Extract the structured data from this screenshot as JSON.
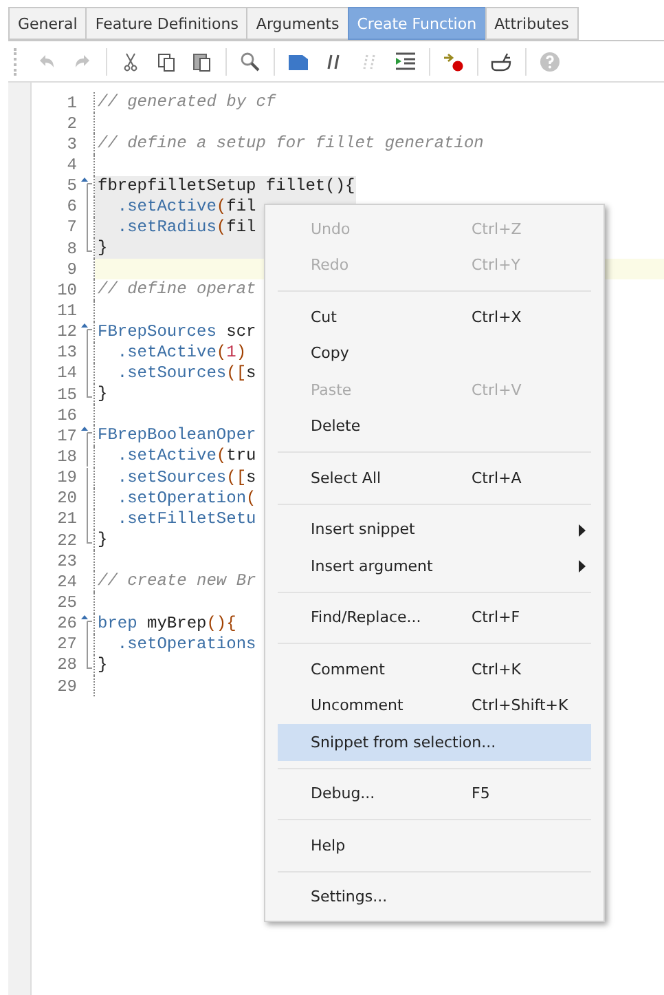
{
  "tabs": [
    {
      "label": "General",
      "selected": false
    },
    {
      "label": "Feature Definitions",
      "selected": false
    },
    {
      "label": "Arguments",
      "selected": false
    },
    {
      "label": "Create Function",
      "selected": true
    },
    {
      "label": "Attributes",
      "selected": false
    }
  ],
  "toolbar": [
    {
      "kind": "undo",
      "disabled": true
    },
    {
      "kind": "redo",
      "disabled": true
    },
    {
      "kind": "sep"
    },
    {
      "kind": "cut",
      "disabled": false
    },
    {
      "kind": "copy",
      "disabled": false
    },
    {
      "kind": "paste",
      "disabled": false
    },
    {
      "kind": "sep"
    },
    {
      "kind": "search",
      "disabled": false
    },
    {
      "kind": "sep"
    },
    {
      "kind": "block",
      "disabled": false
    },
    {
      "kind": "comment",
      "disabled": false
    },
    {
      "kind": "uncomment",
      "disabled": true
    },
    {
      "kind": "indent",
      "disabled": false
    },
    {
      "kind": "sep"
    },
    {
      "kind": "breakpoint",
      "disabled": false
    },
    {
      "kind": "sep"
    },
    {
      "kind": "tool",
      "disabled": false
    },
    {
      "kind": "sep"
    },
    {
      "kind": "help",
      "disabled": true
    }
  ],
  "editor": {
    "lines": [
      {
        "number": "1",
        "kind": "plain",
        "selected": false,
        "current": false,
        "segments": [
          {
            "kind": "comment",
            "text": "// generated by cf"
          }
        ]
      },
      {
        "number": "2",
        "kind": "plain",
        "selected": false,
        "current": false
      },
      {
        "number": "3",
        "kind": "plain",
        "selected": false,
        "current": false,
        "segments": [
          {
            "kind": "comment",
            "text": "// define a setup for fillet generation"
          }
        ]
      },
      {
        "number": "4",
        "kind": "plain",
        "selected": false,
        "current": false
      },
      {
        "number": "5",
        "kind": "start",
        "selected": true,
        "current": false,
        "segments": [
          {
            "kind": "plain",
            "text": "fbrepfilletSetup fillet(){"
          }
        ]
      },
      {
        "number": "6",
        "kind": "body",
        "selected": true,
        "current": false,
        "segments": [
          {
            "kind": "method",
            "text": "  .setActive"
          },
          {
            "kind": "paren",
            "text": "("
          },
          {
            "kind": "plain",
            "text": "fil"
          }
        ]
      },
      {
        "number": "7",
        "kind": "body",
        "selected": true,
        "current": false,
        "segments": [
          {
            "kind": "method",
            "text": "  .setRadius"
          },
          {
            "kind": "paren",
            "text": "("
          },
          {
            "kind": "plain",
            "text": "fil"
          }
        ]
      },
      {
        "number": "8",
        "kind": "end",
        "selected": true,
        "current": false,
        "segments": [
          {
            "kind": "plain",
            "text": "}"
          }
        ]
      },
      {
        "number": "9",
        "kind": "plain",
        "selected": false,
        "current": true
      },
      {
        "number": "10",
        "kind": "plain",
        "selected": false,
        "current": false,
        "segments": [
          {
            "kind": "comment",
            "text": "// define operat"
          }
        ]
      },
      {
        "number": "11",
        "kind": "plain",
        "selected": false,
        "current": false
      },
      {
        "number": "12",
        "kind": "start",
        "selected": false,
        "current": false,
        "segments": [
          {
            "kind": "type",
            "text": "FBrepSources"
          },
          {
            "kind": "plain",
            "text": " scr"
          }
        ]
      },
      {
        "number": "13",
        "kind": "body",
        "selected": false,
        "current": false,
        "segments": [
          {
            "kind": "method",
            "text": "  .setActive"
          },
          {
            "kind": "paren",
            "text": "("
          },
          {
            "kind": "number",
            "text": "1"
          },
          {
            "kind": "paren",
            "text": ")"
          }
        ]
      },
      {
        "number": "14",
        "kind": "body",
        "selected": false,
        "current": false,
        "segments": [
          {
            "kind": "method",
            "text": "  .setSources"
          },
          {
            "kind": "paren",
            "text": "(["
          },
          {
            "kind": "plain",
            "text": "s"
          }
        ]
      },
      {
        "number": "15",
        "kind": "end",
        "selected": false,
        "current": false,
        "segments": [
          {
            "kind": "plain",
            "text": "}"
          }
        ]
      },
      {
        "number": "16",
        "kind": "plain",
        "selected": false,
        "current": false
      },
      {
        "number": "17",
        "kind": "start",
        "selected": false,
        "current": false,
        "segments": [
          {
            "kind": "type",
            "text": "FBrepBooleanOper"
          }
        ]
      },
      {
        "number": "18",
        "kind": "body",
        "selected": false,
        "current": false,
        "segments": [
          {
            "kind": "method",
            "text": "  .setActive"
          },
          {
            "kind": "paren",
            "text": "("
          },
          {
            "kind": "plain",
            "text": "tru"
          }
        ]
      },
      {
        "number": "19",
        "kind": "body",
        "selected": false,
        "current": false,
        "segments": [
          {
            "kind": "method",
            "text": "  .setSources"
          },
          {
            "kind": "paren",
            "text": "(["
          },
          {
            "kind": "plain",
            "text": "s"
          }
        ]
      },
      {
        "number": "20",
        "kind": "body",
        "selected": false,
        "current": false,
        "segments": [
          {
            "kind": "method",
            "text": "  .setOperation"
          },
          {
            "kind": "paren",
            "text": "("
          }
        ]
      },
      {
        "number": "21",
        "kind": "body",
        "selected": false,
        "current": false,
        "segments": [
          {
            "kind": "method",
            "text": "  .setFilletSetu"
          }
        ]
      },
      {
        "number": "22",
        "kind": "end",
        "selected": false,
        "current": false,
        "segments": [
          {
            "kind": "plain",
            "text": "}"
          }
        ]
      },
      {
        "number": "23",
        "kind": "plain",
        "selected": false,
        "current": false
      },
      {
        "number": "24",
        "kind": "plain",
        "selected": false,
        "current": false,
        "segments": [
          {
            "kind": "comment",
            "text": "// create new Br"
          }
        ]
      },
      {
        "number": "25",
        "kind": "plain",
        "selected": false,
        "current": false
      },
      {
        "number": "26",
        "kind": "start",
        "selected": false,
        "current": false,
        "segments": [
          {
            "kind": "type",
            "text": "brep"
          },
          {
            "kind": "plain",
            "text": " myBrep"
          },
          {
            "kind": "paren",
            "text": "(){"
          }
        ]
      },
      {
        "number": "27",
        "kind": "body",
        "selected": false,
        "current": false,
        "segments": [
          {
            "kind": "method",
            "text": "  .setOperations"
          }
        ]
      },
      {
        "number": "28",
        "kind": "end",
        "selected": false,
        "current": false,
        "segments": [
          {
            "kind": "plain",
            "text": "}"
          }
        ]
      },
      {
        "number": "29",
        "kind": "plain",
        "selected": false,
        "current": false
      }
    ]
  },
  "context_menu": {
    "items": [
      {
        "kind": "item",
        "label": "Undo",
        "shortcut": "Ctrl+Z",
        "disabled": true,
        "selected": false,
        "submenu": false
      },
      {
        "kind": "item",
        "label": "Redo",
        "shortcut": "Ctrl+Y",
        "disabled": true,
        "selected": false,
        "submenu": false
      },
      {
        "kind": "separator"
      },
      {
        "kind": "item",
        "label": "Cut",
        "shortcut": "Ctrl+X",
        "disabled": false,
        "selected": false,
        "submenu": false
      },
      {
        "kind": "item",
        "label": "Copy",
        "disabled": false,
        "selected": false,
        "submenu": false
      },
      {
        "kind": "item",
        "label": "Paste",
        "shortcut": "Ctrl+V",
        "disabled": true,
        "selected": false,
        "submenu": false
      },
      {
        "kind": "item",
        "label": "Delete",
        "disabled": false,
        "selected": false,
        "submenu": false
      },
      {
        "kind": "separator"
      },
      {
        "kind": "item",
        "label": "Select All",
        "shortcut": "Ctrl+A",
        "disabled": false,
        "selected": false,
        "submenu": false
      },
      {
        "kind": "separator"
      },
      {
        "kind": "item",
        "label": "Insert snippet",
        "disabled": false,
        "selected": false,
        "submenu": true
      },
      {
        "kind": "item",
        "label": "Insert argument",
        "disabled": false,
        "selected": false,
        "submenu": true
      },
      {
        "kind": "separator"
      },
      {
        "kind": "item",
        "label": "Find/Replace...",
        "shortcut": "Ctrl+F",
        "disabled": false,
        "selected": false,
        "submenu": false
      },
      {
        "kind": "separator"
      },
      {
        "kind": "item",
        "label": "Comment",
        "shortcut": "Ctrl+K",
        "disabled": false,
        "selected": false,
        "submenu": false
      },
      {
        "kind": "item",
        "label": "Uncomment",
        "shortcut": "Ctrl+Shift+K",
        "disabled": false,
        "selected": false,
        "submenu": false
      },
      {
        "kind": "item",
        "label": "Snippet from selection...",
        "disabled": false,
        "selected": true,
        "submenu": false
      },
      {
        "kind": "separator"
      },
      {
        "kind": "item",
        "label": "Debug...",
        "shortcut": "F5",
        "disabled": false,
        "selected": false,
        "submenu": false
      },
      {
        "kind": "separator"
      },
      {
        "kind": "item",
        "label": "Help",
        "disabled": false,
        "selected": false,
        "submenu": false
      },
      {
        "kind": "separator"
      },
      {
        "kind": "item",
        "label": "Settings...",
        "disabled": false,
        "selected": false,
        "submenu": false
      }
    ]
  }
}
